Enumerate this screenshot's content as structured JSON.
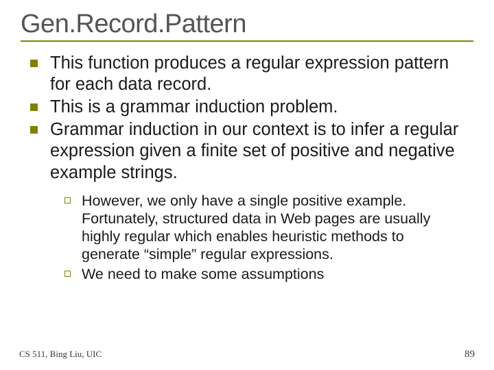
{
  "slide": {
    "title": "Gen.Record.Pattern",
    "bullets": [
      "This function produces a regular expression pattern for each data record.",
      "This is a grammar induction problem.",
      "Grammar induction in our context is to infer a regular expression given a finite set of positive and negative example strings."
    ],
    "subbullets": [
      "However, we only have a single positive example. Fortunately, structured data in Web pages are usually highly regular which enables heuristic methods to generate “simple” regular expressions.",
      "We need to make some assumptions"
    ],
    "footer_left": "CS 511, Bing Liu, UIC",
    "footer_right": "89"
  }
}
